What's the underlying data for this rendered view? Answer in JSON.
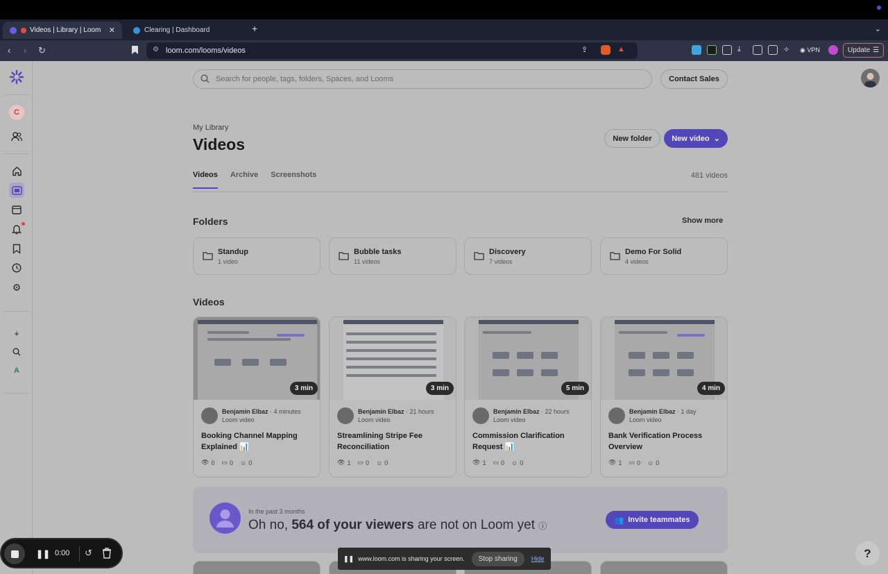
{
  "browser": {
    "tabs": [
      {
        "label": "Videos | Library | Loom"
      },
      {
        "label": "Clearing | Dashboard"
      }
    ],
    "url": "loom.com/looms/videos",
    "vpn_label": "VPN",
    "update_label": "Update"
  },
  "header": {
    "search_placeholder": "Search for people, tags, folders, Spaces, and Looms",
    "contact_label": "Contact Sales"
  },
  "sidebar": {
    "workspace_initial": "C",
    "bottom_initial": "A"
  },
  "page": {
    "breadcrumb": "My Library",
    "title": "Videos",
    "new_folder_label": "New folder",
    "new_video_label": "New video",
    "tabs": [
      "Videos",
      "Archive",
      "Screenshots"
    ],
    "video_count": "481 videos",
    "folders_heading": "Folders",
    "show_more_label": "Show more",
    "videos_heading": "Videos"
  },
  "folders": [
    {
      "name": "Standup",
      "count": "1 video"
    },
    {
      "name": "Bubble tasks",
      "count": "11 videos"
    },
    {
      "name": "Discovery",
      "count": "7 videos"
    },
    {
      "name": "Demo For Solid",
      "count": "4 videos"
    }
  ],
  "videos": [
    {
      "duration": "3 min",
      "author": "Benjamin Elbaz",
      "time": " · 4 minutes",
      "type": "Loom video",
      "title": "Booking Channel Mapping Explained 📊",
      "views": "0",
      "comments": "0",
      "reactions": "0"
    },
    {
      "duration": "3 min",
      "author": "Benjamin Elbaz",
      "time": " · 21 hours",
      "type": "Loom video",
      "title": "Streamlining Stripe Fee Reconciliation",
      "views": "1",
      "comments": "0",
      "reactions": "0"
    },
    {
      "duration": "5 min",
      "author": "Benjamin Elbaz",
      "time": " · 22 hours",
      "type": "Loom video",
      "title": "Commission Clarification Request 📊",
      "views": "1",
      "comments": "0",
      "reactions": "0"
    },
    {
      "duration": "4 min",
      "author": "Benjamin Elbaz",
      "time": " · 1 day",
      "type": "Loom video",
      "title": "Bank Verification Process Overview",
      "views": "1",
      "comments": "0",
      "reactions": "0"
    }
  ],
  "banner": {
    "subtitle": "In the past 3 months",
    "prefix": "Oh no, ",
    "highlight": "564 of your viewers",
    "suffix": " are not on Loom yet",
    "info_icon": "ⓘ",
    "invite_label": "Invite teammates"
  },
  "recorder": {
    "time": "0:00"
  },
  "share_bar": {
    "message": "www.loom.com is sharing your screen.",
    "stop_label": "Stop sharing",
    "hide_label": "Hide"
  },
  "help_label": "?",
  "colors": {
    "accent": "#5346b8",
    "notification": "#d9453c"
  }
}
